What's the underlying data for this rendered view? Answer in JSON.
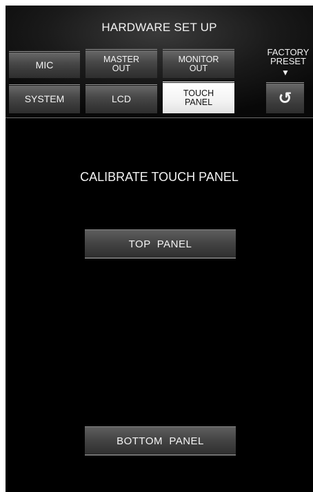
{
  "header": {
    "title": "HARDWARE SET UP",
    "factory_preset_label": "FACTORY\nPRESET",
    "factory_arrow": "▼",
    "reset_icon_glyph": "↺"
  },
  "tabs": [
    {
      "label": "MIC",
      "active": false
    },
    {
      "label": "MASTER\nOUT",
      "active": false
    },
    {
      "label": "MONITOR\nOUT",
      "active": false
    },
    {
      "label": "SYSTEM",
      "active": false
    },
    {
      "label": "LCD",
      "active": false
    },
    {
      "label": "TOUCH\nPANEL",
      "active": true
    }
  ],
  "main": {
    "title": "CALIBRATE TOUCH PANEL",
    "top_panel_label": "TOP  PANEL",
    "bottom_panel_label": "BOTTOM  PANEL"
  },
  "colors": {
    "background": "#000000",
    "button": "#4a4a4a",
    "active_button": "#f3f3f3",
    "text": "#f2f2f2"
  }
}
